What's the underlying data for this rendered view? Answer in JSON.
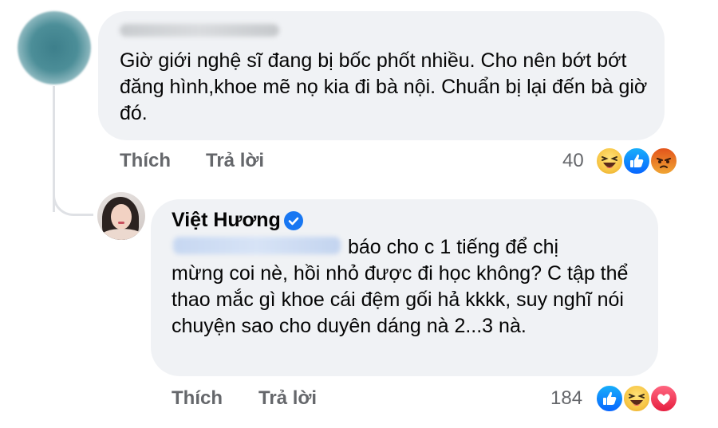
{
  "comment_1": {
    "text": "Giờ giới nghệ sĩ đang bị bốc phốt nhiều. Cho nên bớt bớt đăng hình,khoe mẽ nọ kia đi bà nội. Chuẩn bị lại đến bà giờ đó.",
    "like_label": "Thích",
    "reply_label": "Trả lời",
    "reaction_count": "40",
    "reactions": [
      "laugh-icon",
      "like-icon",
      "angry-icon"
    ]
  },
  "comment_2": {
    "author": "Việt Hương",
    "text_first_line": "báo cho c 1 tiếng để chị",
    "text_rest": "mừng coi nè, hồi nhỏ được đi học không? C tập thể thao mắc gì khoe cái đệm gối hả kkkk, suy nghĩ nói chuyện sao cho duyên dáng nà 2...3 nà.",
    "like_label": "Thích",
    "reply_label": "Trả lời",
    "reaction_count": "184",
    "reactions": [
      "like-icon",
      "laugh-icon",
      "love-icon"
    ]
  },
  "colors": {
    "bubble": "#f0f2f5",
    "secondary_text": "#65676b",
    "verified": "#1877f2"
  }
}
